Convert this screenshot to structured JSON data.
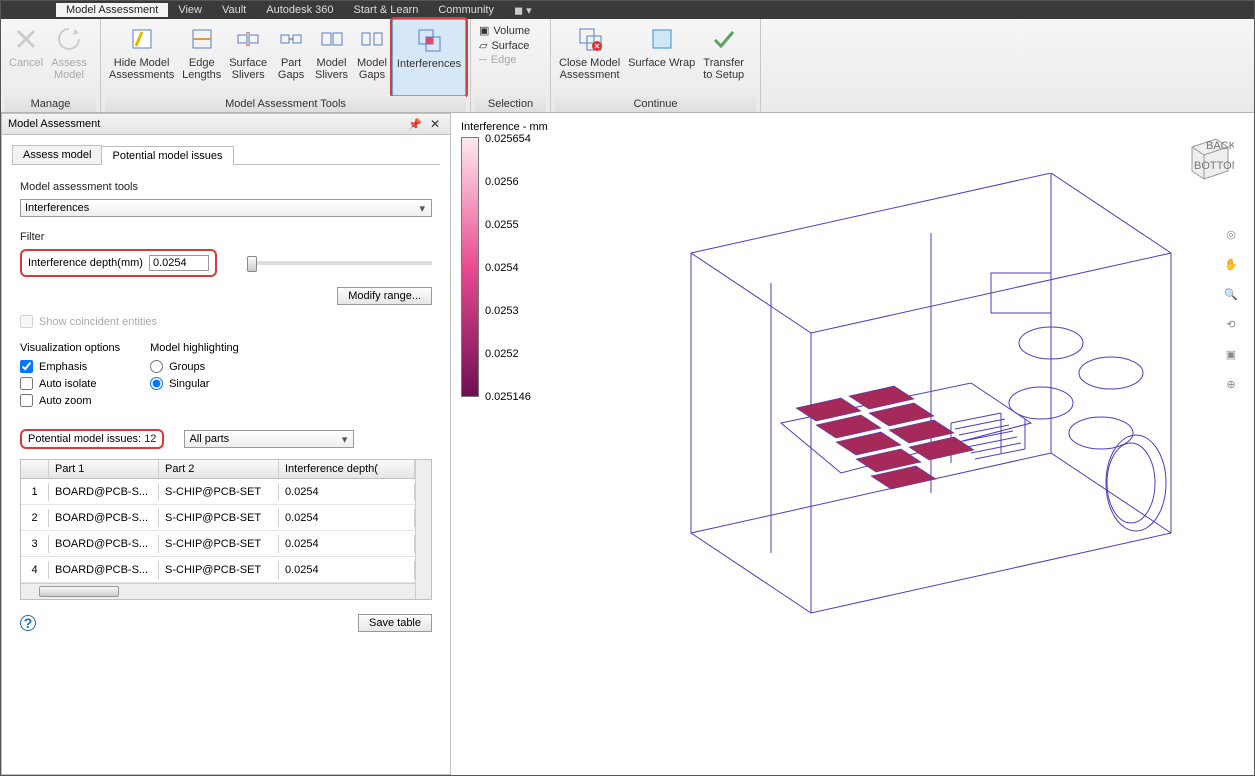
{
  "menubar": {
    "items": [
      "Model Assessment",
      "View",
      "Vault",
      "Autodesk 360",
      "Start & Learn",
      "Community"
    ],
    "active": 0
  },
  "ribbon": {
    "groups": {
      "manage": {
        "label": "Manage",
        "cancel": "Cancel",
        "assess": "Assess\nModel"
      },
      "tools": {
        "label": "Model Assessment Tools",
        "hide": "Hide Model\nAssessments",
        "edge": "Edge\nLengths",
        "surface_slivers": "Surface\nSlivers",
        "part_gaps": "Part\nGaps",
        "model_slivers": "Model\nSlivers",
        "model_gaps": "Model\nGaps",
        "interferences": "Interferences"
      },
      "selection": {
        "label": "Selection",
        "volume": "Volume",
        "surface": "Surface",
        "edge": "Edge"
      },
      "continue": {
        "label": "Continue",
        "close_model": "Close Model\nAssessment",
        "surface_wrap": "Surface Wrap",
        "transfer": "Transfer\nto Setup"
      }
    }
  },
  "panel": {
    "title": "Model Assessment",
    "tabs": {
      "assess": "Assess model",
      "issues": "Potential model issues"
    },
    "section_tools": "Model assessment tools",
    "tool_select": "Interferences",
    "filter_label": "Filter",
    "depth_label": "Interference depth(mm)",
    "depth_value": "0.0254",
    "modify_range": "Modify range...",
    "show_coincident": "Show coincident entities",
    "viz_label": "Visualization options",
    "viz_emphasis": "Emphasis",
    "viz_isolate": "Auto isolate",
    "viz_zoom": "Auto zoom",
    "highlight_label": "Model highlighting",
    "highlight_groups": "Groups",
    "highlight_singular": "Singular",
    "issues_label": "Potential model issues:",
    "issues_count": "12",
    "all_parts": "All parts",
    "columns": {
      "idx": "",
      "p1": "Part 1",
      "p2": "Part 2",
      "depth": "Interference depth("
    },
    "rows": [
      {
        "idx": "1",
        "p1": "BOARD@PCB-S...",
        "p2": "S-CHIP@PCB-SET",
        "depth": "0.0254"
      },
      {
        "idx": "2",
        "p1": "BOARD@PCB-S...",
        "p2": "S-CHIP@PCB-SET",
        "depth": "0.0254"
      },
      {
        "idx": "3",
        "p1": "BOARD@PCB-S...",
        "p2": "S-CHIP@PCB-SET",
        "depth": "0.0254"
      },
      {
        "idx": "4",
        "p1": "BOARD@PCB-S...",
        "p2": "S-CHIP@PCB-SET",
        "depth": "0.0254"
      }
    ],
    "save_table": "Save table"
  },
  "legend": {
    "title": "Interference - mm",
    "ticks": [
      "0.025654",
      "0.0256",
      "0.0255",
      "0.0254",
      "0.0253",
      "0.0252",
      "0.025146"
    ]
  },
  "viewcube": {
    "face1": "BACK",
    "face2": "BOTTOM"
  },
  "colors": {
    "highlight_red": "#d93a3a",
    "selected_blue": "#d6e7f7",
    "model_line": "#4a3fc1",
    "chip_fill": "#a62a59"
  }
}
